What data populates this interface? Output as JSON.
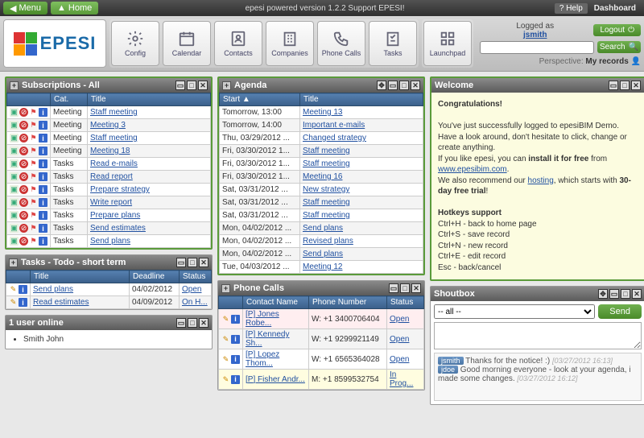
{
  "topbar": {
    "menu": "Menu",
    "home": "Home",
    "center": "epesi powered  version 1.2.2   Support EPESI!",
    "help": "Help",
    "dashboard": "Dashboard"
  },
  "user": {
    "logged_as": "Logged as",
    "username": "jsmith",
    "logout": "Logout",
    "search": "Search",
    "perspective_label": "Perspective:",
    "perspective_value": "My records"
  },
  "tools": [
    {
      "label": "Config"
    },
    {
      "label": "Calendar"
    },
    {
      "label": "Contacts"
    },
    {
      "label": "Companies"
    },
    {
      "label": "Phone Calls"
    },
    {
      "label": "Tasks"
    },
    {
      "label": "Launchpad"
    }
  ],
  "subs": {
    "title": "Subscriptions - All",
    "cols": [
      "",
      "Cat.",
      "Title"
    ],
    "rows": [
      [
        "Meeting",
        "Staff meeting"
      ],
      [
        "Meeting",
        "Meeting 3"
      ],
      [
        "Meeting",
        "Staff meeting"
      ],
      [
        "Meeting",
        "Meeting 18"
      ],
      [
        "Tasks",
        "Read e-mails"
      ],
      [
        "Tasks",
        "Read report"
      ],
      [
        "Tasks",
        "Prepare strategy"
      ],
      [
        "Tasks",
        "Write report"
      ],
      [
        "Tasks",
        "Prepare plans"
      ],
      [
        "Tasks",
        "Send estimates"
      ],
      [
        "Tasks",
        "Send plans"
      ]
    ]
  },
  "tasks": {
    "title": "Tasks - Todo - short term",
    "cols": [
      "",
      "Title",
      "Deadline",
      "Status"
    ],
    "rows": [
      [
        "Send plans",
        "04/02/2012",
        "Open"
      ],
      [
        "Read estimates",
        "04/09/2012",
        "On H..."
      ]
    ]
  },
  "users_online": {
    "title": "1 user online",
    "list": [
      "Smith John"
    ]
  },
  "agenda": {
    "title": "Agenda",
    "cols": [
      "Start ▲",
      "Title"
    ],
    "rows": [
      [
        "Tomorrow, 13:00",
        "Meeting 13"
      ],
      [
        "Tomorrow, 14:00",
        "Important e-mails"
      ],
      [
        "Thu, 03/29/2012 ...",
        "Changed strategy"
      ],
      [
        "Fri, 03/30/2012 1...",
        "Staff meeting"
      ],
      [
        "Fri, 03/30/2012 1...",
        "Staff meeting"
      ],
      [
        "Fri, 03/30/2012 1...",
        "Meeting 16"
      ],
      [
        "Sat, 03/31/2012 ...",
        "New strategy"
      ],
      [
        "Sat, 03/31/2012 ...",
        "Staff meeting"
      ],
      [
        "Sat, 03/31/2012 ...",
        "Staff meeting"
      ],
      [
        "Mon, 04/02/2012 ...",
        "Send plans"
      ],
      [
        "Mon, 04/02/2012 ...",
        "Revised plans"
      ],
      [
        "Mon, 04/02/2012 ...",
        "Send plans"
      ],
      [
        "Tue, 04/03/2012 ...",
        "Meeting 12"
      ]
    ]
  },
  "phone": {
    "title": "Phone Calls",
    "cols": [
      "",
      "Contact Name",
      "Phone Number",
      "Status"
    ],
    "rows": [
      {
        "name": "[P] Jones Robe...",
        "num": "W: +1 3400706404",
        "status": "Open",
        "cls": "hl"
      },
      {
        "name": "[P] Kennedy Sh...",
        "num": "W: +1 9299921149",
        "status": "Open",
        "cls": ""
      },
      {
        "name": "[P] Lopez Thom...",
        "num": "W: +1 6565364028",
        "status": "Open",
        "cls": ""
      },
      {
        "name": "[P] Fisher Andr...",
        "num": "M: +1 8599532754",
        "status": "In Prog...",
        "cls": "hl2"
      }
    ]
  },
  "welcome": {
    "title": "Welcome",
    "congrats": "Congratulations!",
    "p1a": "You've just successfully logged to epesiBIM Demo. Have a look around, don't hesitate to click, change or create anything.",
    "p1b": "If you like epesi, you can ",
    "p1c": "install it for free",
    "p1d": " from ",
    "link1": "www.epesibim.com",
    "p1e": ".",
    "p2a": "We also recommend our ",
    "link2": "hosting",
    "p2b": ", which starts with ",
    "p2c": "30-day free trial",
    "p2d": "!",
    "hk_title": "Hotkeys support",
    "hk": [
      "Ctrl+H - back to home page",
      "Ctrl+S - save record",
      "Ctrl+N - new record",
      "Ctrl+E - edit record",
      "Esc - back/cancel"
    ]
  },
  "shout": {
    "title": "Shoutbox",
    "option": "-- all --",
    "send": "Send",
    "msgs": [
      {
        "u": "jsmith",
        "t": "Thanks for the notice! :)",
        "ts": "[03/27/2012 16:13]"
      },
      {
        "u": "jdoe",
        "t": "Good morning everyone - look at your agenda, i made some changes.",
        "ts": "[03/27/2012 16:12]"
      }
    ]
  }
}
